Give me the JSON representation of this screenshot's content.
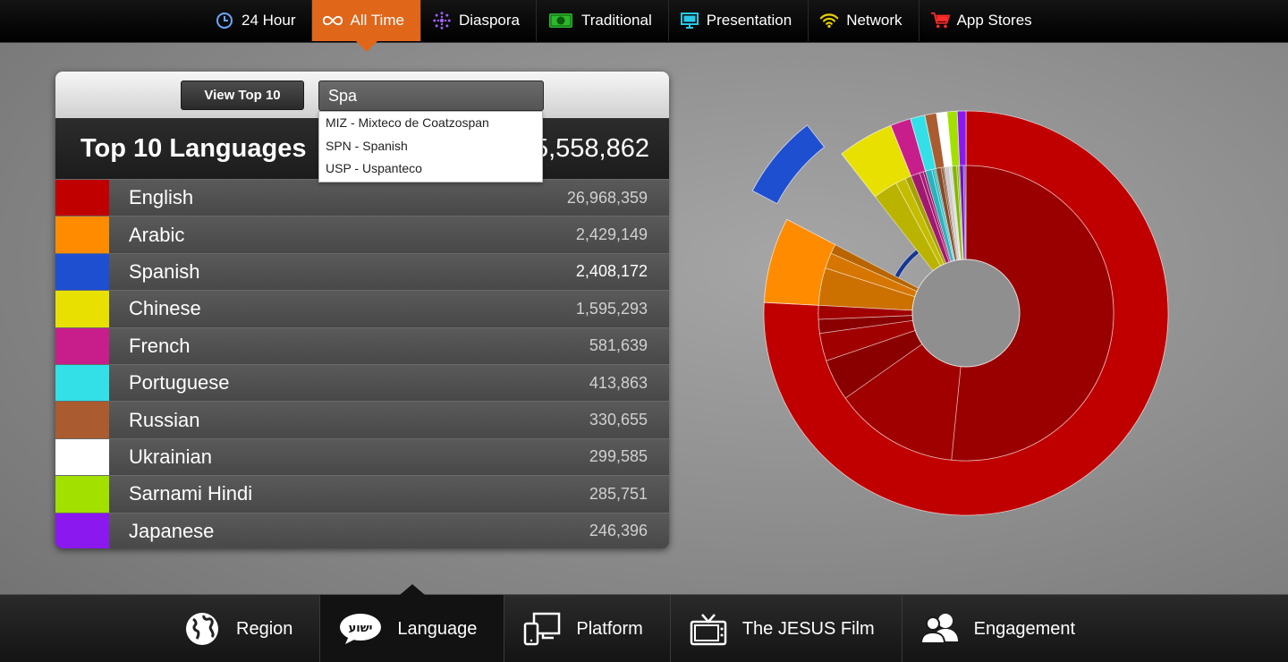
{
  "top_nav": [
    {
      "label": "24 Hour",
      "icon": "clock-icon"
    },
    {
      "label": "All Time",
      "icon": "infinity-icon",
      "active": true
    },
    {
      "label": "Diaspora",
      "icon": "burst-icon"
    },
    {
      "label": "Traditional",
      "icon": "money-icon"
    },
    {
      "label": "Presentation",
      "icon": "monitor-icon"
    },
    {
      "label": "Network",
      "icon": "wifi-icon"
    },
    {
      "label": "App Stores",
      "icon": "cart-icon"
    }
  ],
  "panel": {
    "view_button": "View Top 10",
    "search_value": "Spa",
    "title": "Top 10 Languages",
    "total": "5,558,862"
  },
  "dropdown": [
    "MIZ - Mixteco de Coatzospan",
    "SPN - Spanish",
    "USP - Uspanteco"
  ],
  "languages": [
    {
      "name": "English",
      "value": "26,968,359",
      "color": "#c00000"
    },
    {
      "name": "Arabic",
      "value": "2,429,149",
      "color": "#ff8c00"
    },
    {
      "name": "Spanish",
      "value": "2,408,172",
      "color": "#1f4fd1"
    },
    {
      "name": "Chinese",
      "value": "1,595,293",
      "color": "#e8e000"
    },
    {
      "name": "French",
      "value": "581,639",
      "color": "#c81e8c"
    },
    {
      "name": "Portuguese",
      "value": "413,863",
      "color": "#33e0e8"
    },
    {
      "name": "Russian",
      "value": "330,655",
      "color": "#aa5c30"
    },
    {
      "name": "Ukrainian",
      "value": "299,585",
      "color": "#ffffff"
    },
    {
      "name": "Sarnami Hindi",
      "value": "285,751",
      "color": "#a2e000"
    },
    {
      "name": "Japanese",
      "value": "246,396",
      "color": "#8c18f0"
    }
  ],
  "chart_data": {
    "type": "pie",
    "categories": [
      "English",
      "Arabic",
      "Spanish",
      "Chinese",
      "French",
      "Portuguese",
      "Russian",
      "Ukrainian",
      "Sarnami Hindi",
      "Japanese"
    ],
    "values": [
      26968359,
      2429149,
      2408172,
      1595293,
      581639,
      413863,
      330655,
      299585,
      285751,
      246396
    ],
    "exploded": "Spanish",
    "colors": [
      "#c00000",
      "#ff8c00",
      "#1f4fd1",
      "#e8e000",
      "#c81e8c",
      "#33e0e8",
      "#aa5c30",
      "#ffffff",
      "#a2e000",
      "#8c18f0"
    ]
  },
  "bottom_nav": [
    {
      "label": "Region",
      "icon": "globe-icon"
    },
    {
      "label": "Language",
      "icon": "speech-bubble-icon",
      "icon_text": "ישוע",
      "active": true
    },
    {
      "label": "Platform",
      "icon": "devices-icon"
    },
    {
      "label": "The JESUS Film",
      "icon": "tv-icon"
    },
    {
      "label": "Engagement",
      "icon": "people-icon"
    }
  ]
}
